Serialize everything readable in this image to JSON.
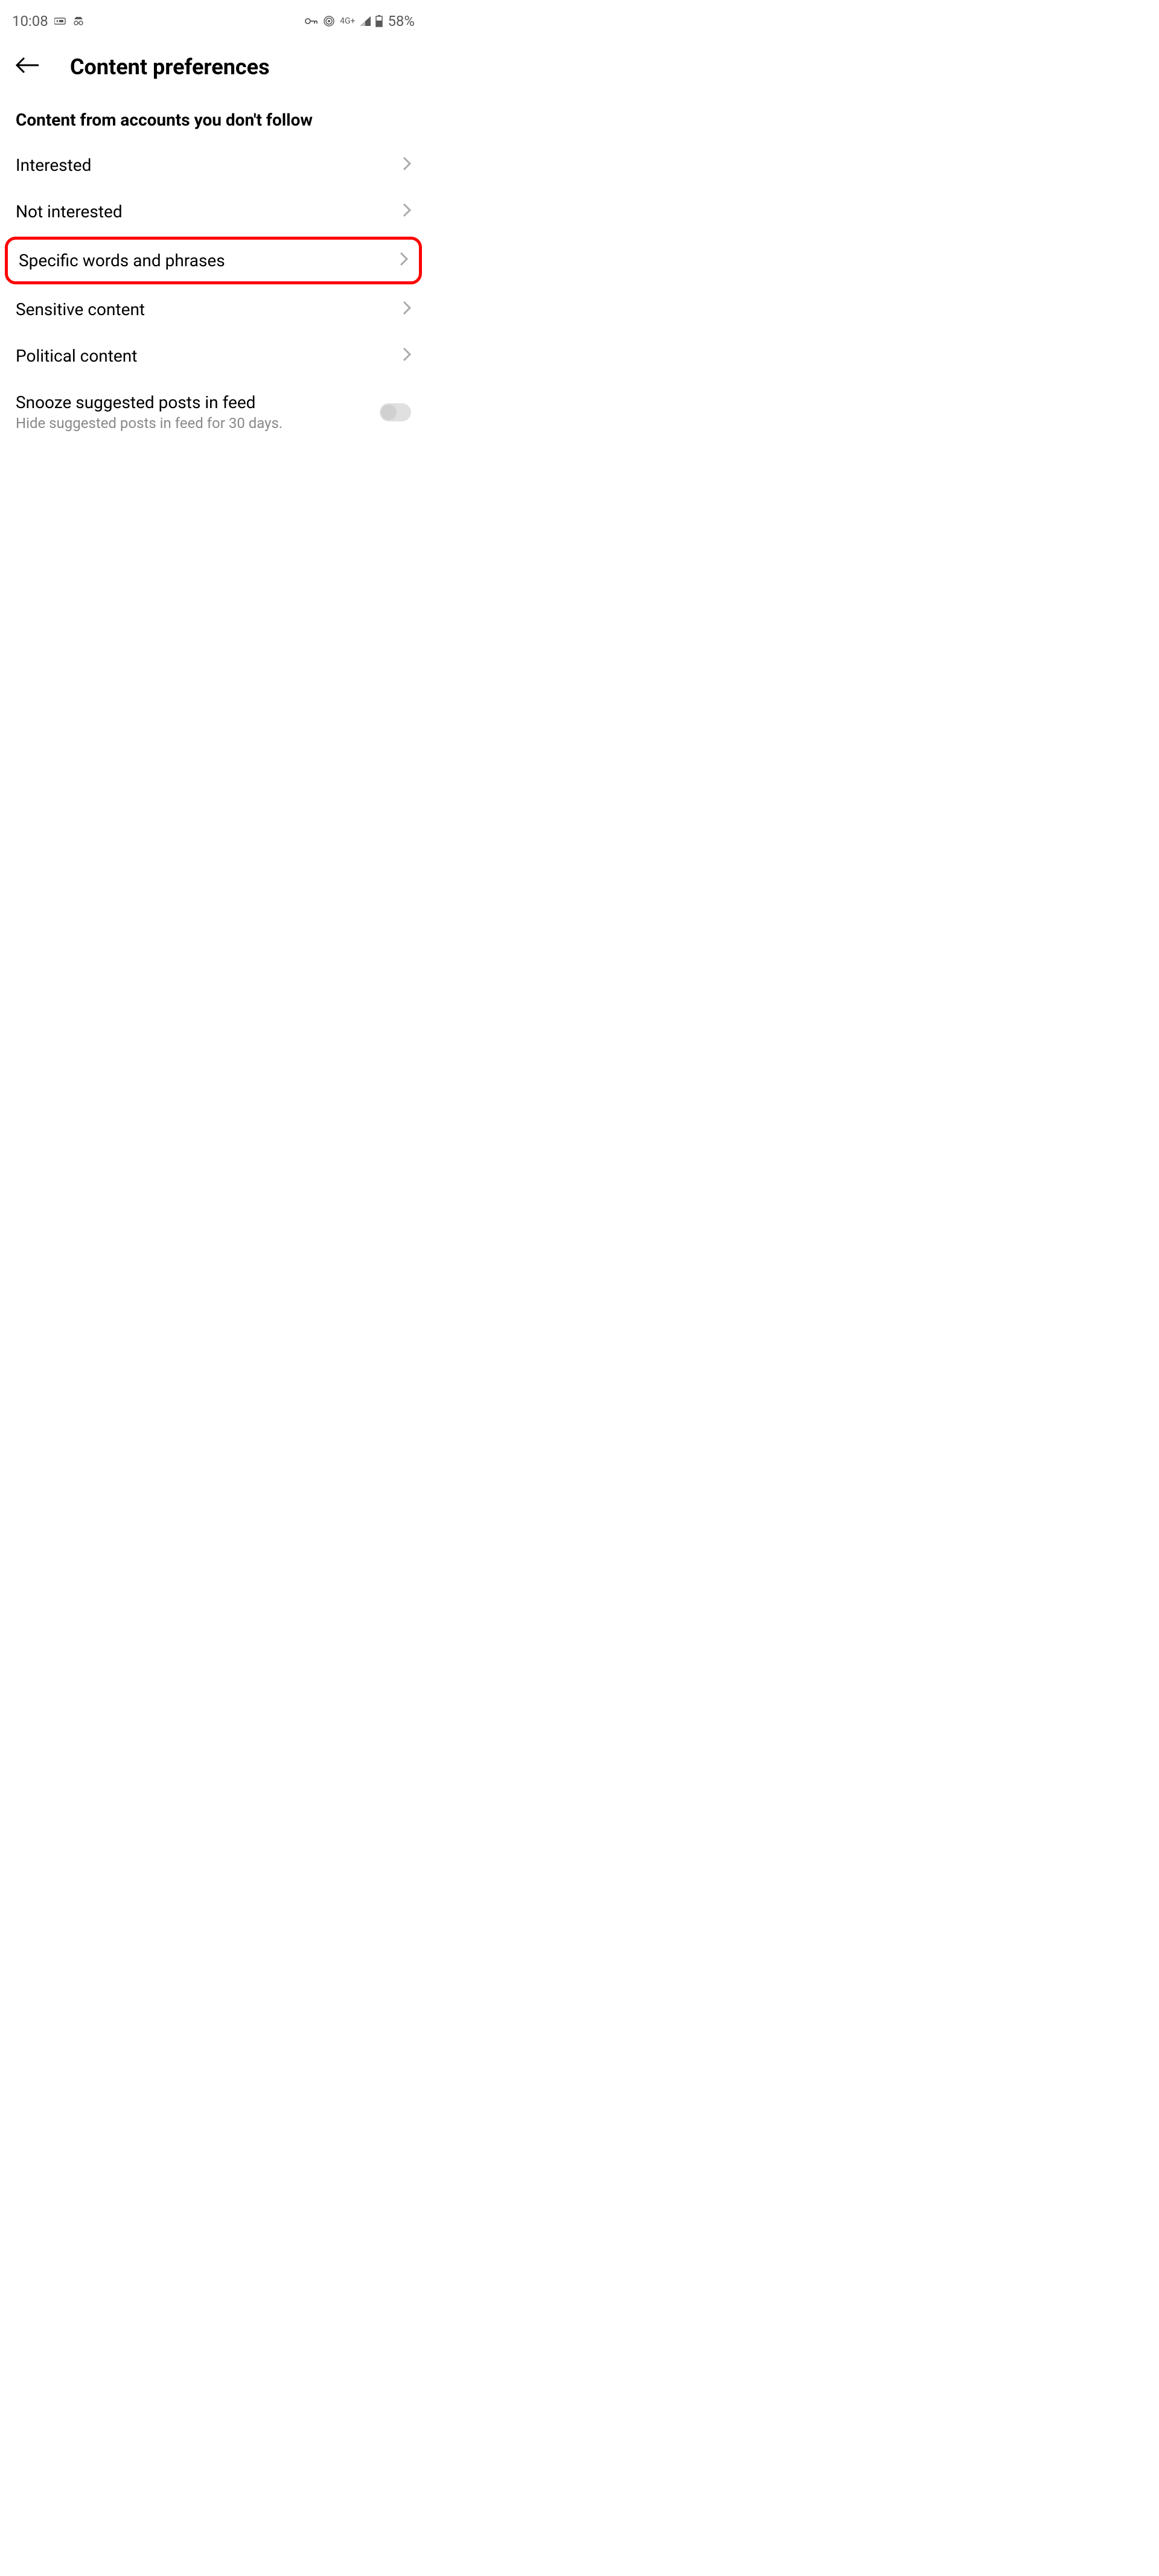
{
  "status": {
    "time": "10:08",
    "network": "4G+",
    "battery": "58%"
  },
  "header": {
    "title": "Content preferences"
  },
  "section": {
    "title": "Content from accounts you don't follow"
  },
  "menu": {
    "interested": "Interested",
    "not_interested": "Not interested",
    "specific_words": "Specific words and phrases",
    "sensitive_content": "Sensitive content",
    "political_content": "Political content"
  },
  "toggle": {
    "label": "Snooze suggested posts in feed",
    "subtitle": "Hide suggested posts in feed for 30 days."
  }
}
